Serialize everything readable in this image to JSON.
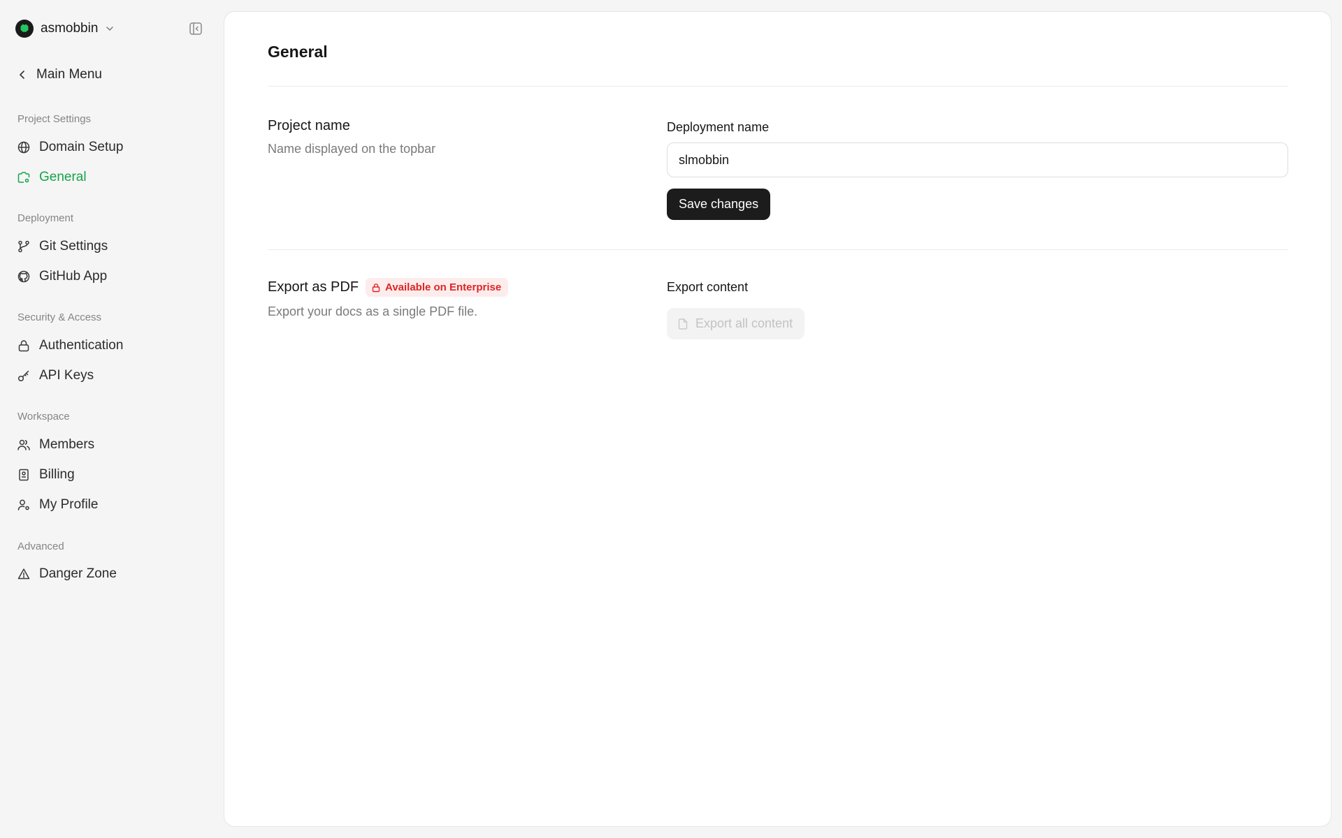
{
  "workspace": {
    "name": "asmobbin"
  },
  "sidebar": {
    "back_label": "Main Menu",
    "sections": [
      {
        "label": "Project Settings",
        "items": [
          {
            "label": "Domain Setup",
            "icon": "globe-icon"
          },
          {
            "label": "General",
            "icon": "settings-gear-icon",
            "active": true
          }
        ]
      },
      {
        "label": "Deployment",
        "items": [
          {
            "label": "Git Settings",
            "icon": "git-branch-icon"
          },
          {
            "label": "GitHub App",
            "icon": "github-icon"
          }
        ]
      },
      {
        "label": "Security & Access",
        "items": [
          {
            "label": "Authentication",
            "icon": "lock-icon"
          },
          {
            "label": "API Keys",
            "icon": "key-icon"
          }
        ]
      },
      {
        "label": "Workspace",
        "items": [
          {
            "label": "Members",
            "icon": "users-icon"
          },
          {
            "label": "Billing",
            "icon": "receipt-icon"
          },
          {
            "label": "My Profile",
            "icon": "user-cog-icon"
          }
        ]
      },
      {
        "label": "Advanced",
        "items": [
          {
            "label": "Danger Zone",
            "icon": "warning-triangle-icon"
          }
        ]
      }
    ]
  },
  "main": {
    "title": "General",
    "project": {
      "title": "Project name",
      "description": "Name displayed on the topbar",
      "field_label": "Deployment name",
      "field_value": "slmobbin",
      "save_label": "Save changes"
    },
    "export": {
      "title": "Export as PDF",
      "badge": "Available on Enterprise",
      "description": "Export your docs as a single PDF file.",
      "field_label": "Export content",
      "button_label": "Export all content"
    }
  },
  "colors": {
    "accent": "#16a34a",
    "badge_bg": "#fdecec",
    "badge_text": "#dc2626",
    "primary_button": "#1c1c1c"
  }
}
